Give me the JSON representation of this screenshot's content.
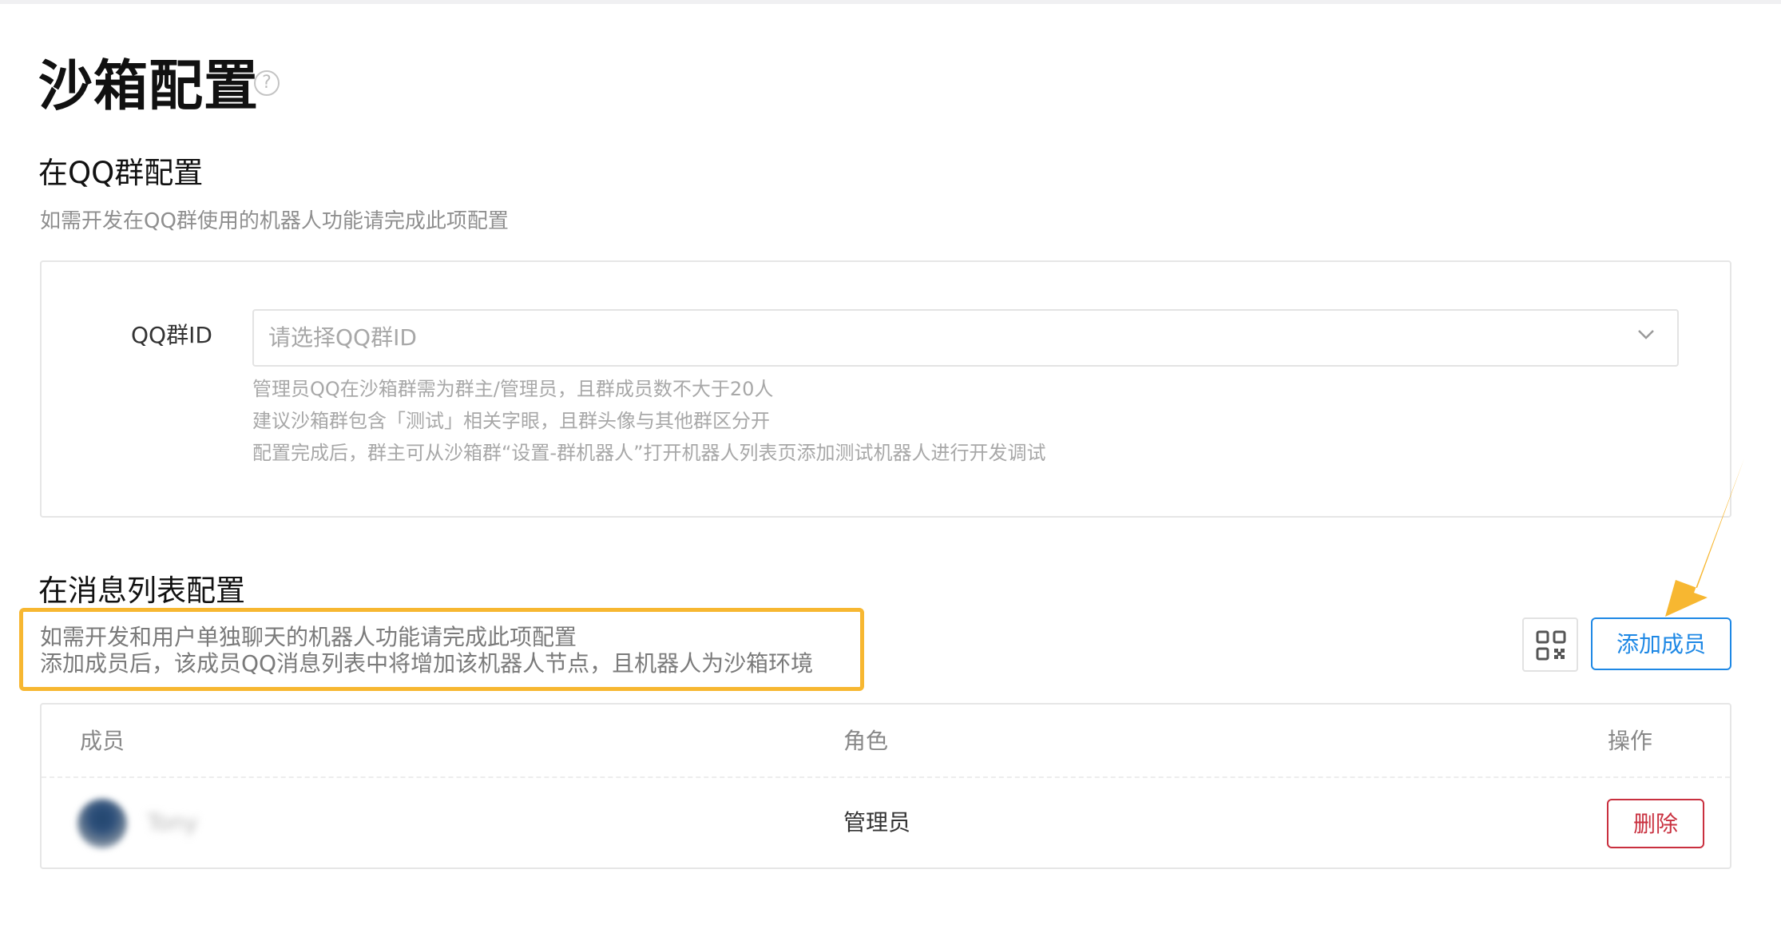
{
  "page": {
    "title": "沙箱配置",
    "help_icon": "question-circle-icon"
  },
  "qq_group_section": {
    "title": "在QQ群配置",
    "description": "如需开发在QQ群使用的机器人功能请完成此项配置",
    "field_label": "QQ群ID",
    "select_placeholder": "请选择QQ群ID",
    "hints": [
      "管理员QQ在沙箱群需为群主/管理员，且群成员数不大于20人",
      "建议沙箱群包含「测试」相关字眼，且群头像与其他群区分开",
      "配置完成后，群主可从沙箱群“设置-群机器人”打开机器人列表页添加测试机器人进行开发调试"
    ]
  },
  "message_list_section": {
    "title": "在消息列表配置",
    "description_lines": [
      "如需开发和用户单独聊天的机器人功能请完成此项配置",
      "添加成员后，该成员QQ消息列表中将增加该机器人节点，且机器人为沙箱环境"
    ],
    "qr_icon": "qr-code-icon",
    "add_member_label": "添加成员",
    "table": {
      "headers": {
        "member": "成员",
        "role": "角色",
        "action": "操作"
      },
      "rows": [
        {
          "name": "Tony",
          "role": "管理员",
          "delete_label": "删除"
        }
      ]
    }
  },
  "colors": {
    "callout_border": "#f7b731",
    "arrow": "#f7b731",
    "primary": "#1e88e5",
    "danger": "#c9303f"
  }
}
